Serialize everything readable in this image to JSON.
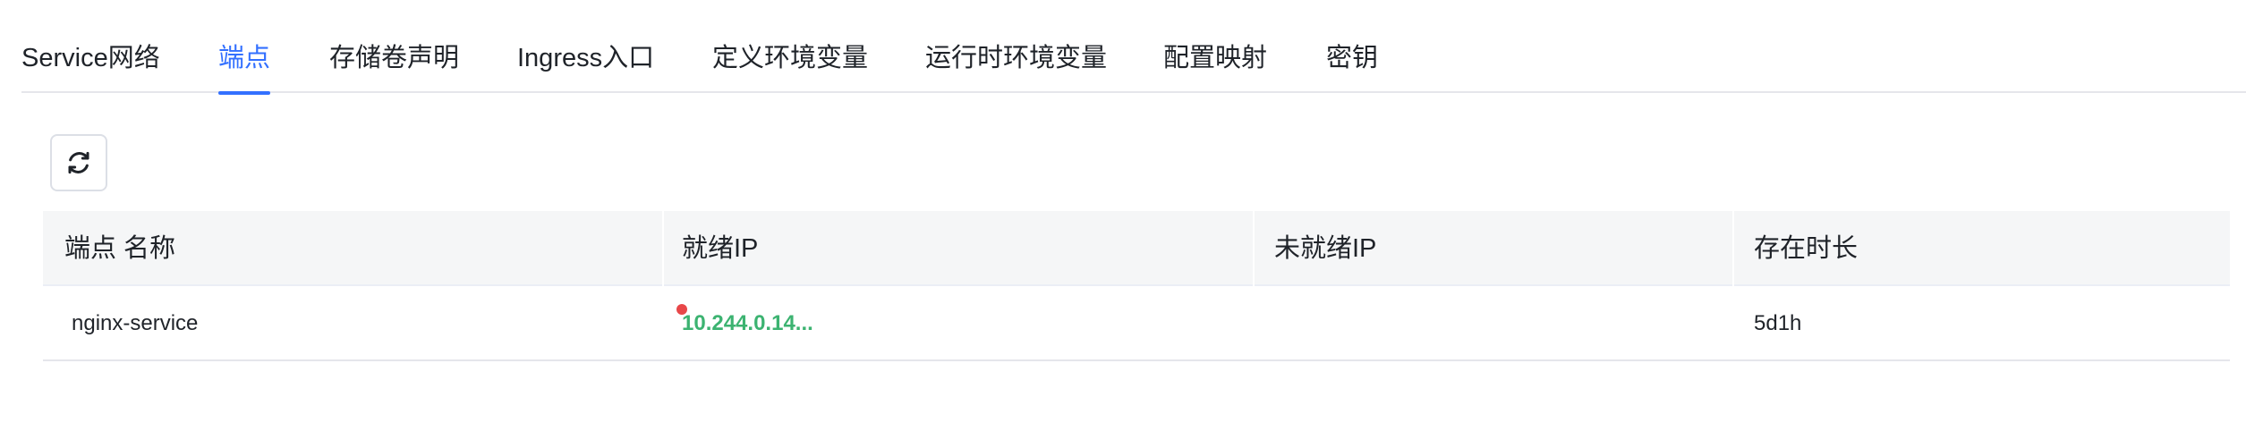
{
  "tabs": [
    {
      "label": "Service网络",
      "active": false
    },
    {
      "label": "端点",
      "active": true
    },
    {
      "label": "存储卷声明",
      "active": false
    },
    {
      "label": "Ingress入口",
      "active": false
    },
    {
      "label": "定义环境变量",
      "active": false
    },
    {
      "label": "运行时环境变量",
      "active": false
    },
    {
      "label": "配置映射",
      "active": false
    },
    {
      "label": "密钥",
      "active": false
    }
  ],
  "toolbar": {
    "refresh_icon": "refresh-icon"
  },
  "table": {
    "columns": [
      "端点 名称",
      "就绪IP",
      "未就绪IP",
      "存在时长"
    ],
    "rows": [
      {
        "name": "nginx-service",
        "ready_ip": "10.244.0.14...",
        "not_ready_ip": "",
        "age": "5d1h",
        "status_color": "#e84749"
      }
    ]
  },
  "colors": {
    "accent": "#3370ff",
    "ready_ip": "#3cb371",
    "status_dot": "#e84749"
  }
}
